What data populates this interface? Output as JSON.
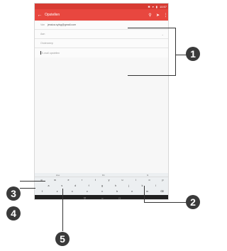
{
  "status_bar": {
    "icons": [
      "bluetooth-icon",
      "wifi-icon",
      "battery-icon"
    ],
    "time": "10:57"
  },
  "toolbar": {
    "title": "Opstellen",
    "icons": [
      "back-arrow-icon",
      "attach-icon",
      "send-icon",
      "more-icon"
    ]
  },
  "compose": {
    "from_label": "Van",
    "from_value": "jessica.sylvg@gmail.com",
    "to_label": "Aan",
    "subject_placeholder": "Onderwerp",
    "body_placeholder": "E-mail opstellen"
  },
  "keyboard": {
    "suggestions": [
      "Hoe",
      "Dit",
      "Ik"
    ],
    "row1": [
      "q",
      "w",
      "e",
      "r",
      "t",
      "y",
      "u",
      "i",
      "o",
      "p"
    ],
    "row2": [
      "a",
      "s",
      "d",
      "f",
      "g",
      "h",
      "j",
      "k",
      "l"
    ],
    "row3": [
      "z",
      "x",
      "c",
      "v",
      "b",
      "n",
      "m"
    ],
    "bottom_left": "?123",
    "space_label": "NL · EN"
  },
  "callouts": [
    "1",
    "2",
    "3",
    "4",
    "5"
  ],
  "colors": {
    "app_bar": "#e8473f",
    "status_bar": "#d73b33",
    "enter_key": "#21b7a2"
  }
}
